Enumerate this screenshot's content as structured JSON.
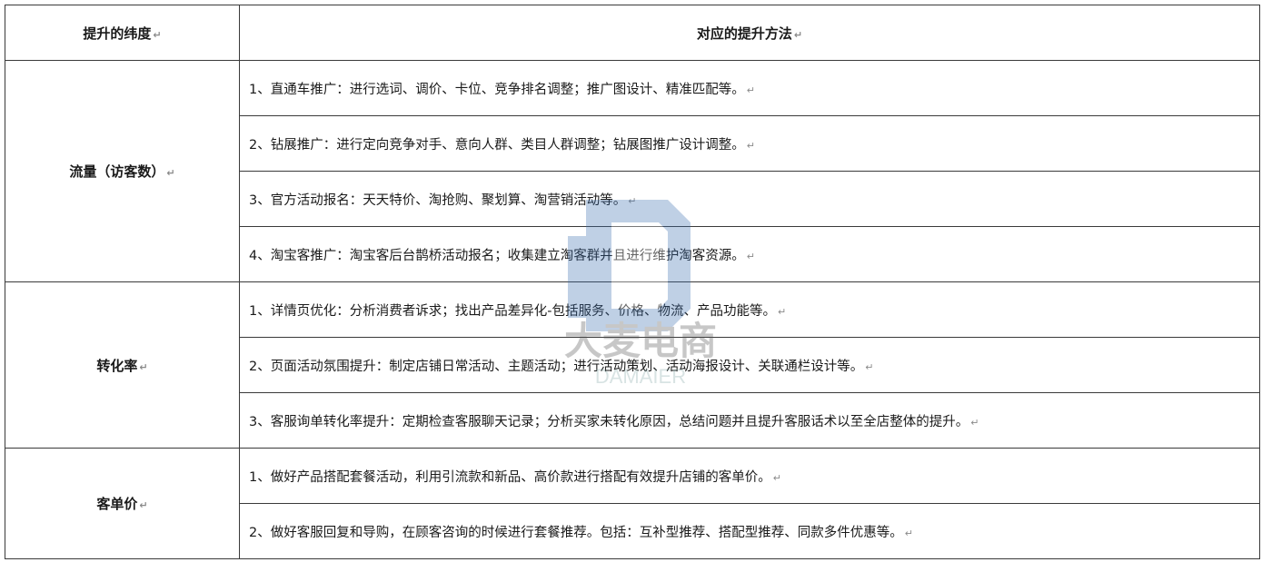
{
  "header": {
    "dimension": "提升的纬度",
    "method": "对应的提升方法"
  },
  "mark": "↵",
  "watermark": {
    "cn": "大麦电商",
    "en": "DAMAIER"
  },
  "groups": [
    {
      "dimension": "流量（访客数）",
      "methods": [
        "1、直通车推广：进行选词、调价、卡位、竞争排名调整；推广图设计、精准匹配等。",
        "2、钻展推广：进行定向竞争对手、意向人群、类目人群调整；钻展图推广设计调整。",
        "3、官方活动报名：天天特价、淘抢购、聚划算、淘营销活动等。",
        "4、淘宝客推广：淘宝客后台鹊桥活动报名；收集建立淘客群并且进行维护淘客资源。"
      ]
    },
    {
      "dimension": "转化率",
      "methods": [
        "1、详情页优化：分析消费者诉求；找出产品差异化-包括服务、价格、物流、产品功能等。",
        "2、页面活动氛围提升：制定店铺日常活动、主题活动；进行活动策划、活动海报设计、关联通栏设计等。",
        "3、客服询单转化率提升：定期检查客服聊天记录；分析买家未转化原因，总结问题并且提升客服话术以至全店整体的提升。"
      ]
    },
    {
      "dimension": "客单价",
      "methods": [
        "1、做好产品搭配套餐活动，利用引流款和新品、高价款进行搭配有效提升店铺的客单价。",
        "2、做好客服回复和导购，在顾客咨询的时候进行套餐推荐。包括：互补型推荐、搭配型推荐、同款多件优惠等。"
      ]
    }
  ]
}
